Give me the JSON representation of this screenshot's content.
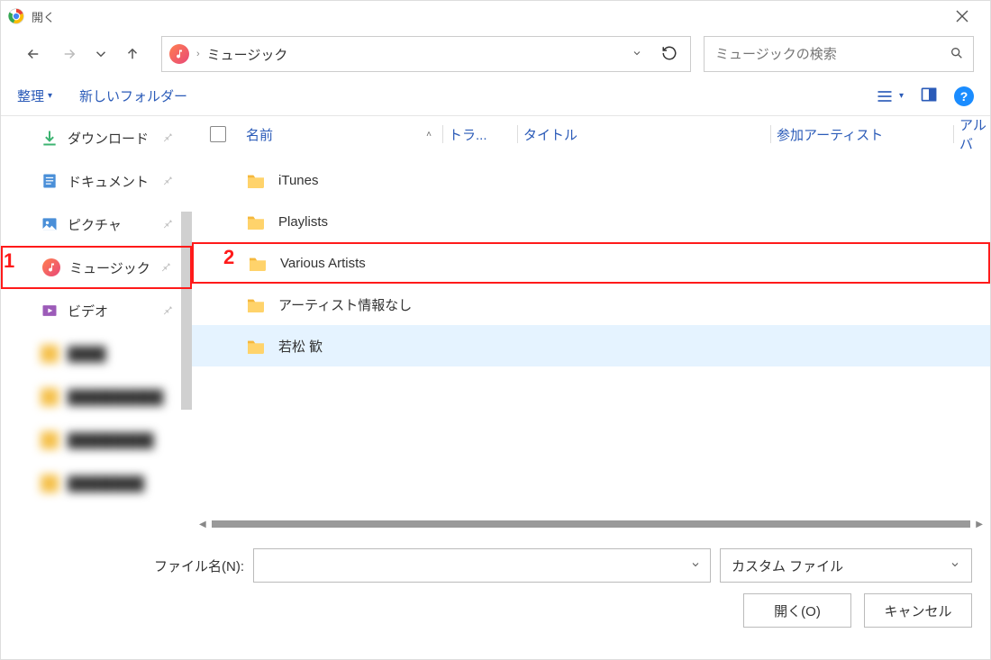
{
  "title": "開く",
  "breadcrumb": {
    "location": "ミュージック"
  },
  "search": {
    "placeholder": "ミュージックの検索"
  },
  "toolbar": {
    "organize": "整理",
    "new_folder": "新しいフォルダー"
  },
  "columns": {
    "name": "名前",
    "track": "トラ...",
    "title": "タイトル",
    "artist": "参加アーティスト",
    "album": "アルバ"
  },
  "sidebar": {
    "items": [
      {
        "label": "ダウンロード",
        "icon": "download"
      },
      {
        "label": "ドキュメント",
        "icon": "document"
      },
      {
        "label": "ピクチャ",
        "icon": "picture"
      },
      {
        "label": "ミュージック",
        "icon": "music"
      },
      {
        "label": "ビデオ",
        "icon": "video"
      }
    ]
  },
  "files": [
    {
      "name": "iTunes"
    },
    {
      "name": "Playlists"
    },
    {
      "name": "Various Artists"
    },
    {
      "name": "アーティスト情報なし"
    },
    {
      "name": "若松 歓"
    }
  ],
  "annotations": {
    "a1": "1",
    "a2": "2"
  },
  "footer": {
    "filename_label": "ファイル名(N):",
    "filetype": "カスタム ファイル",
    "open": "開く(O)",
    "cancel": "キャンセル"
  }
}
